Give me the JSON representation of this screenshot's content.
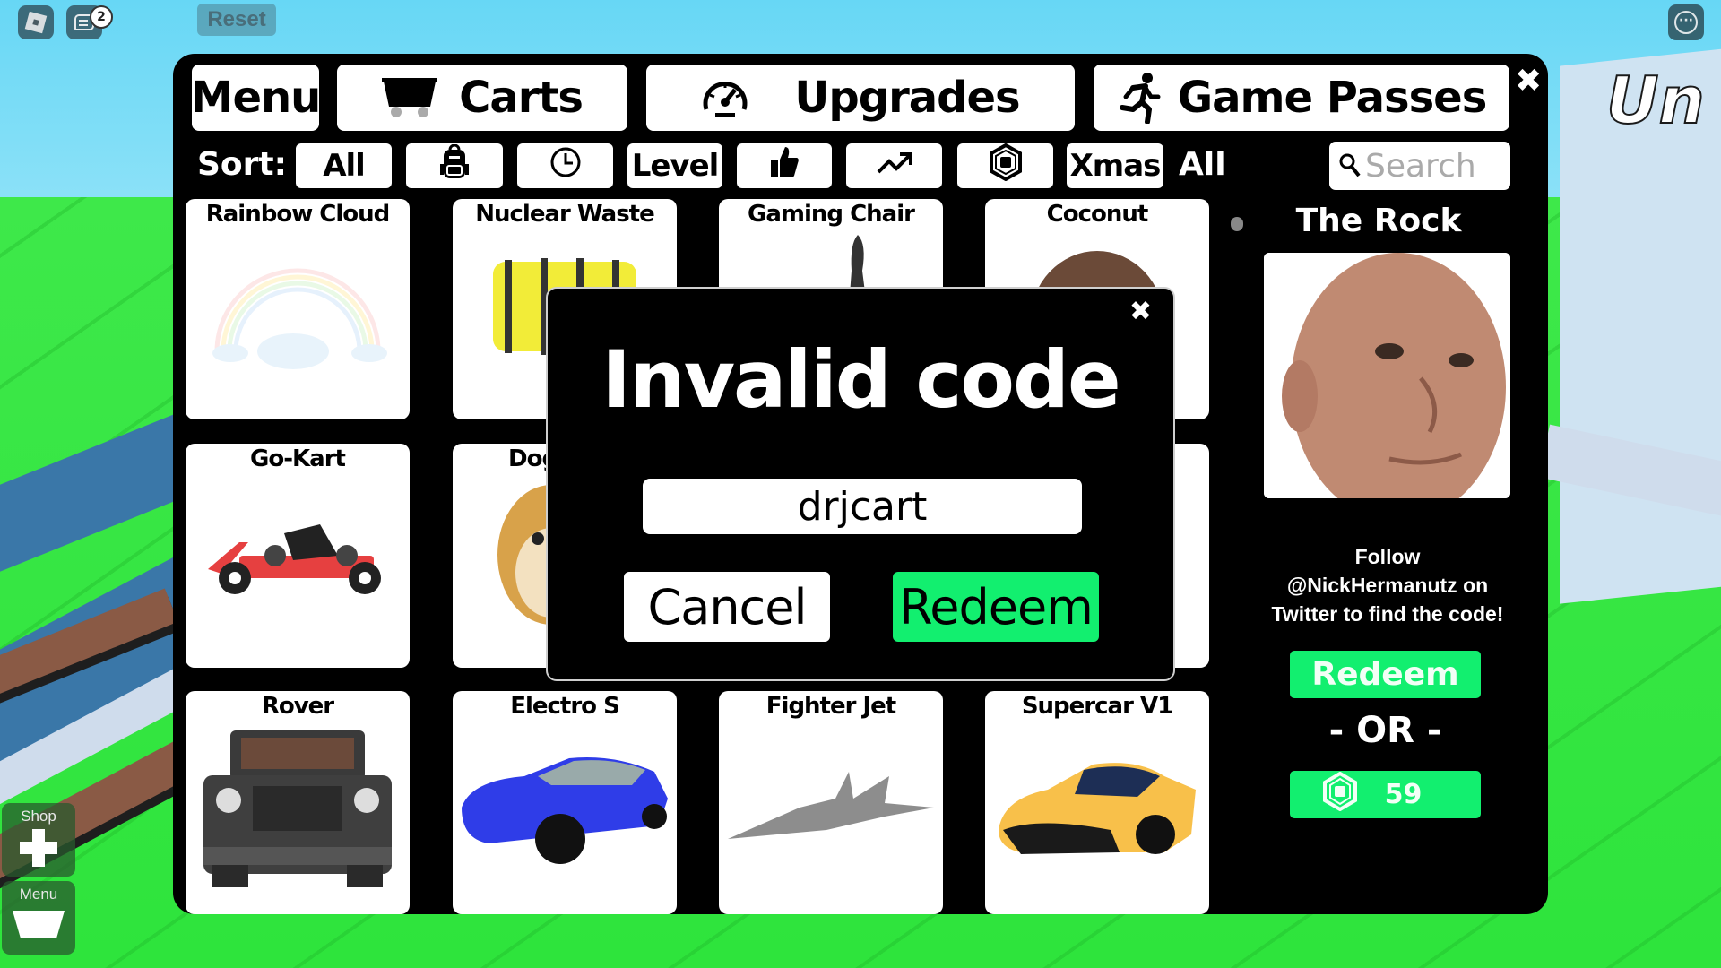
{
  "topbar": {
    "roblox_menu_icon": "roblox-logo-icon",
    "chat_icon": "chat-icon",
    "chat_badge_count": "2",
    "reset_label": "Reset",
    "more_icon": "more-options-icon"
  },
  "world": {
    "sign_text": "Un"
  },
  "hud": {
    "shop_label": "Shop",
    "menu_label": "Menu"
  },
  "panel": {
    "tabs": [
      {
        "label": "Menu",
        "icon": ""
      },
      {
        "label": "Carts",
        "icon": "cart-icon"
      },
      {
        "label": "Upgrades",
        "icon": "speedometer-icon"
      },
      {
        "label": "Game Passes",
        "icon": "running-person-icon"
      }
    ],
    "close_icon": "close-icon",
    "sort": {
      "label": "Sort:",
      "buttons": [
        {
          "label": "All"
        },
        {
          "icon": "backpack-icon"
        },
        {
          "icon": "clock-icon"
        },
        {
          "label": "Level"
        },
        {
          "icon": "thumbs-up-icon"
        },
        {
          "icon": "trending-up-icon"
        },
        {
          "icon": "robux-icon"
        },
        {
          "label": "Xmas"
        }
      ],
      "current_filter": "All"
    },
    "search": {
      "placeholder": "Search",
      "value": ""
    },
    "items": [
      {
        "name": "Rainbow Cloud"
      },
      {
        "name": "Nuclear Waste"
      },
      {
        "name": "Gaming Chair"
      },
      {
        "name": "Coconut"
      },
      {
        "name": "Go-Kart"
      },
      {
        "name": "Doge"
      },
      {
        "name": ""
      },
      {
        "name": ""
      },
      {
        "name": "Rover"
      },
      {
        "name": "Electro S"
      },
      {
        "name": "Fighter Jet"
      },
      {
        "name": "Supercar V1"
      }
    ]
  },
  "featured": {
    "title": "The Rock",
    "follow_text_line1": "Follow",
    "follow_text_line2": "@NickHermanutz on",
    "follow_text_line3": "Twitter to find the code!",
    "redeem_label": "Redeem",
    "or_label": "- OR -",
    "price": "59",
    "currency_icon": "robux-icon"
  },
  "modal": {
    "title": "Invalid code",
    "code_value": "drjcart",
    "cancel_label": "Cancel",
    "redeem_label": "Redeem"
  },
  "colors": {
    "accent_green": "#12ef6f",
    "panel_bg": "#000000"
  }
}
